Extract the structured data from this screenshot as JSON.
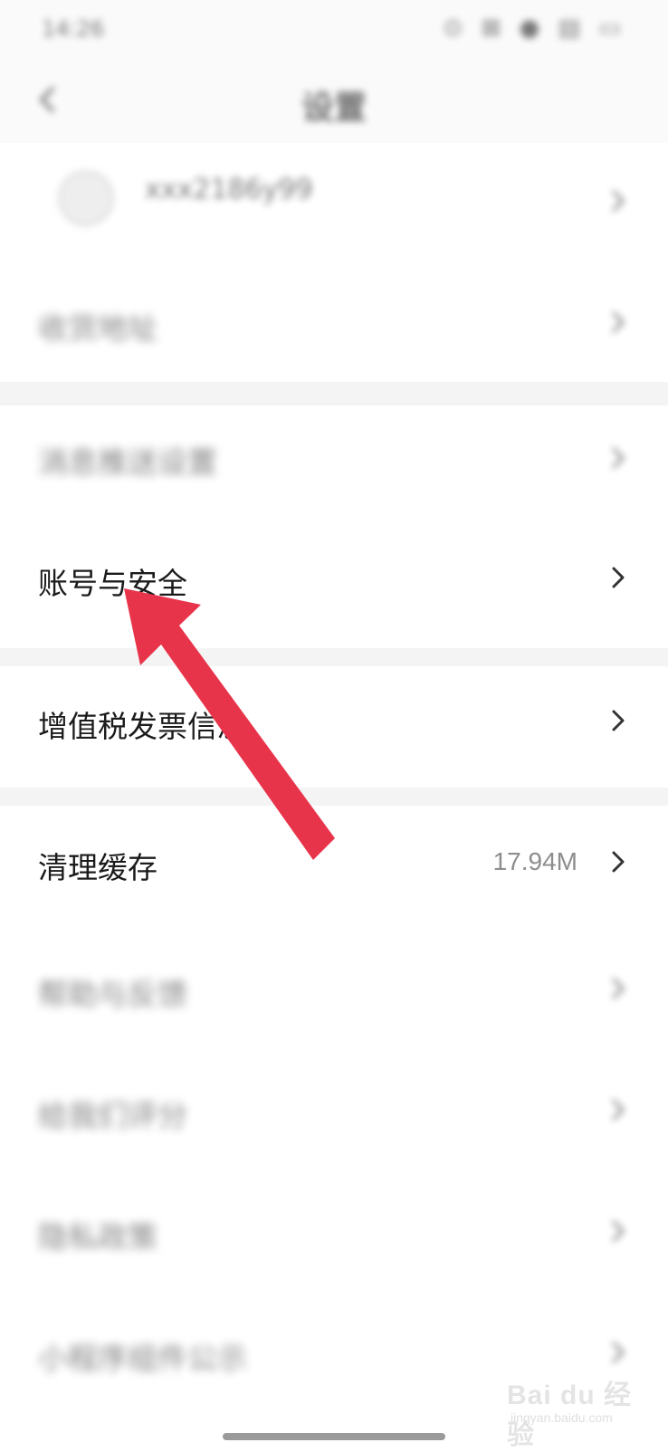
{
  "status_bar": {
    "time": "14:26",
    "icons": "⊙ ⊠ ● ▤ ▭"
  },
  "nav": {
    "title": "设置",
    "back_icon": "chevron-left-icon"
  },
  "profile": {
    "username": "xxx2186y99"
  },
  "rows": [
    {
      "label": "收货地址",
      "blurred": true
    },
    {
      "label": "消息推送设置",
      "blurred": true
    },
    {
      "label": "账号与安全",
      "blurred": false
    },
    {
      "label": "增值税发票信息",
      "blurred": false
    },
    {
      "label": "清理缓存",
      "blurred": false,
      "value": "17.94M"
    },
    {
      "label": "帮助与反馈",
      "blurred": true
    },
    {
      "label": "给我们评分",
      "blurred": true
    },
    {
      "label": "隐私政策",
      "blurred": true
    },
    {
      "label": "小程序组件公示",
      "blurred": true
    }
  ],
  "watermark": {
    "text": "Bai du 经验",
    "sub": "jingyan.baidu.com"
  },
  "colors": {
    "arrow": "#e8344b",
    "background": "#ffffff",
    "separator": "#f4f4f4",
    "value_text": "#8d8d8d"
  }
}
